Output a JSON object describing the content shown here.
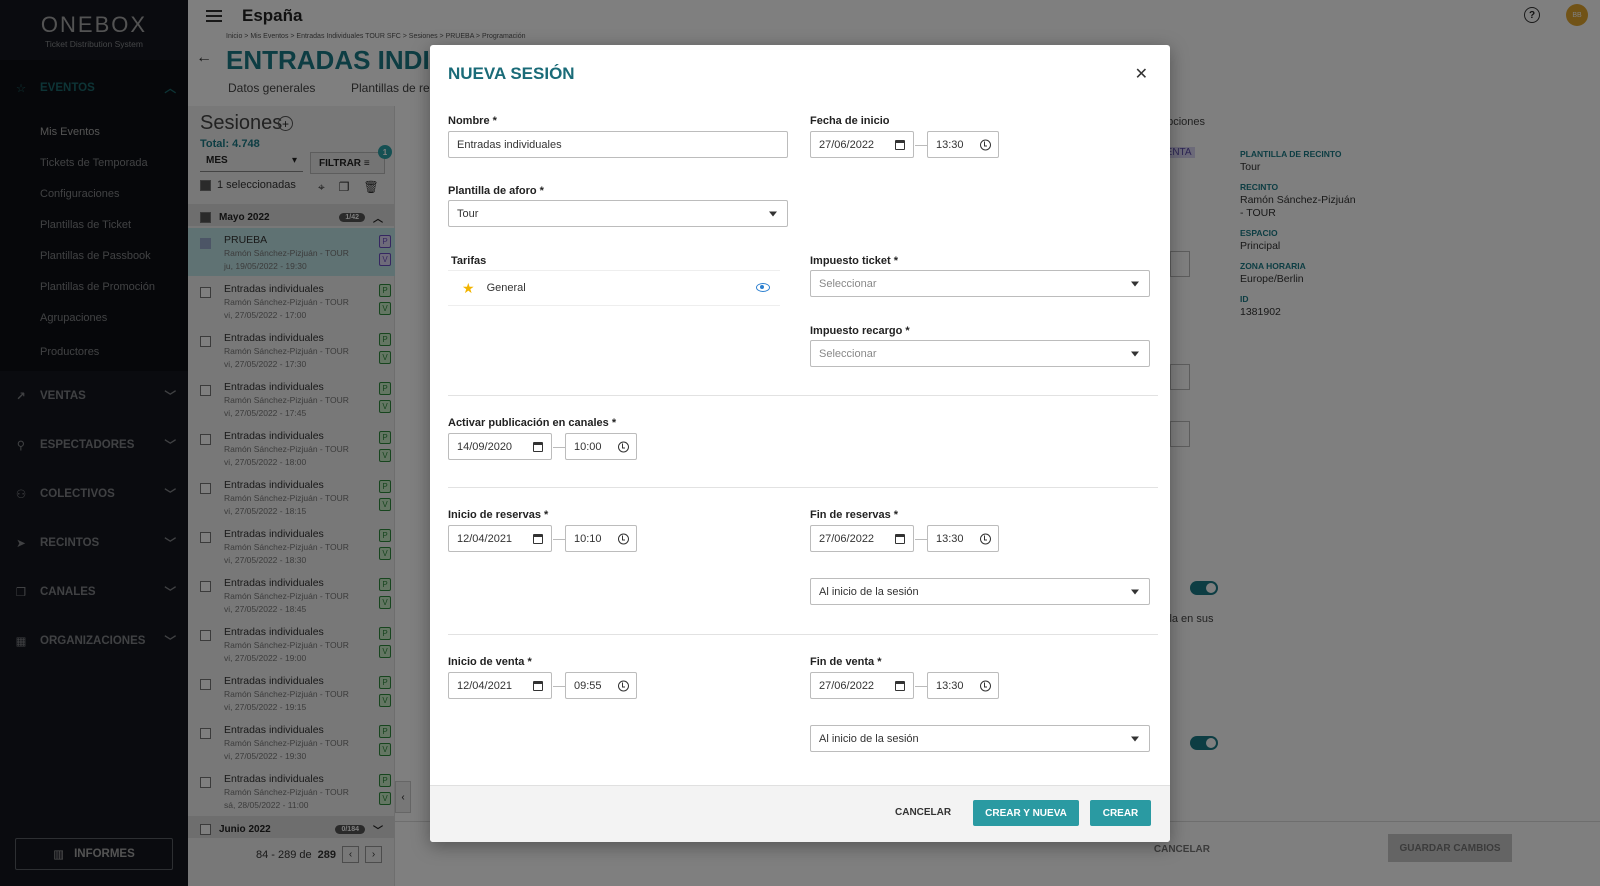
{
  "sidebar": {
    "logo": "ONEBOX",
    "logo_sub": "Ticket Distribution System",
    "sections": [
      {
        "label": "EVENTOS",
        "icon": "star-icon"
      },
      {
        "label": "VENTAS",
        "icon": "trend-icon"
      },
      {
        "label": "ESPECTADORES",
        "icon": "person-icon"
      },
      {
        "label": "COLECTIVOS",
        "icon": "group-icon"
      },
      {
        "label": "RECINTOS",
        "icon": "location-arrow-icon"
      },
      {
        "label": "CANALES",
        "icon": "copy-icon"
      },
      {
        "label": "ORGANIZACIONES",
        "icon": "building-icon"
      }
    ],
    "eventos_items": [
      "Mis Eventos",
      "Tickets de Temporada",
      "Configuraciones",
      "Plantillas de Ticket",
      "Plantillas de Passbook",
      "Plantillas de Promoción",
      "Agrupaciones",
      "Productores"
    ],
    "informes_label": "INFORMES"
  },
  "topbar": {
    "country": "España",
    "help": "?",
    "avatar_initials": "BB"
  },
  "page": {
    "breadcrumb": "Inicio > Mis Eventos > Entradas Individuales TOUR SFC > Sesiones > PRUEBA > Programación",
    "title": "ENTRADAS INDIVIDUALES TOUR SFC",
    "tabs": [
      "Datos generales",
      "Plantillas de re"
    ],
    "right_fragments": {
      "opciones": "opciones",
      "venta_badge": "VENTA",
      "text_frag": "rarla en sus"
    },
    "info": {
      "items": [
        {
          "label": "PLANTILLA DE RECINTO",
          "value": "Tour"
        },
        {
          "label": "RECINTO",
          "value": "Ramón Sánchez-Pizjuán - TOUR"
        },
        {
          "label": "ESPACIO",
          "value": "Principal"
        },
        {
          "label": "ZONA HORARIA",
          "value": "Europe/Berlin"
        },
        {
          "label": "ID",
          "value": "1381902"
        }
      ]
    },
    "footer": {
      "cancel": "CANCELAR",
      "save": "GUARDAR CAMBIOS"
    }
  },
  "sessions": {
    "title": "Sesiones",
    "total": "Total: 4.748",
    "period": "MES",
    "filter_label": "FILTRAR",
    "filter_count": "1",
    "selected_label": "1 seleccionadas",
    "month": "Mayo 2022",
    "month_count": "1/42",
    "next_month": "Junio 2022",
    "next_month_count": "0/184",
    "items": [
      {
        "name": "PRUEBA",
        "venue": "Ramón Sánchez-Pizjuán - TOUR",
        "date": "ju, 19/05/2022 - 19:30",
        "tags": [
          "P",
          "V"
        ]
      },
      {
        "name": "Entradas individuales",
        "venue": "Ramón Sánchez-Pizjuán - TOUR",
        "date": "vi, 27/05/2022 - 17:00",
        "tags": [
          "P",
          "V"
        ]
      },
      {
        "name": "Entradas individuales",
        "venue": "Ramón Sánchez-Pizjuán - TOUR",
        "date": "vi, 27/05/2022 - 17:30",
        "tags": [
          "P",
          "V"
        ]
      },
      {
        "name": "Entradas individuales",
        "venue": "Ramón Sánchez-Pizjuán - TOUR",
        "date": "vi, 27/05/2022 - 17:45",
        "tags": [
          "P",
          "V"
        ]
      },
      {
        "name": "Entradas individuales",
        "venue": "Ramón Sánchez-Pizjuán - TOUR",
        "date": "vi, 27/05/2022 - 18:00",
        "tags": [
          "P",
          "V"
        ]
      },
      {
        "name": "Entradas individuales",
        "venue": "Ramón Sánchez-Pizjuán - TOUR",
        "date": "vi, 27/05/2022 - 18:15",
        "tags": [
          "P",
          "V"
        ]
      },
      {
        "name": "Entradas individuales",
        "venue": "Ramón Sánchez-Pizjuán - TOUR",
        "date": "vi, 27/05/2022 - 18:30",
        "tags": [
          "P",
          "V"
        ]
      },
      {
        "name": "Entradas individuales",
        "venue": "Ramón Sánchez-Pizjuán - TOUR",
        "date": "vi, 27/05/2022 - 18:45",
        "tags": [
          "P",
          "V"
        ]
      },
      {
        "name": "Entradas individuales",
        "venue": "Ramón Sánchez-Pizjuán - TOUR",
        "date": "vi, 27/05/2022 - 19:00",
        "tags": [
          "P",
          "V"
        ]
      },
      {
        "name": "Entradas individuales",
        "venue": "Ramón Sánchez-Pizjuán - TOUR",
        "date": "vi, 27/05/2022 - 19:15",
        "tags": [
          "P",
          "V"
        ]
      },
      {
        "name": "Entradas individuales",
        "venue": "Ramón Sánchez-Pizjuán - TOUR",
        "date": "vi, 27/05/2022 - 19:30",
        "tags": [
          "P",
          "V"
        ]
      },
      {
        "name": "Entradas individuales",
        "venue": "Ramón Sánchez-Pizjuán - TOUR",
        "date": "sá, 28/05/2022 - 11:00",
        "tags": [
          "P",
          "V"
        ]
      }
    ],
    "pager": {
      "range": "84 - 289 de",
      "total": "289"
    }
  },
  "modal": {
    "title": "NUEVA SESIÓN",
    "nombre_label": "Nombre *",
    "nombre_value": "Entradas individuales",
    "fecha_inicio_label": "Fecha de inicio",
    "fecha_inicio_date": "27/06/2022",
    "fecha_inicio_time": "13:30",
    "plantilla_label": "Plantilla de aforo *",
    "plantilla_value": "Tour",
    "tarifas_label": "Tarifas",
    "tarifa_name": "General",
    "impuesto_ticket_label": "Impuesto ticket *",
    "impuesto_ticket_placeholder": "Seleccionar",
    "impuesto_recargo_label": "Impuesto recargo *",
    "impuesto_recargo_placeholder": "Seleccionar",
    "activar_label": "Activar publicación en canales *",
    "activar_date": "14/09/2020",
    "activar_time": "10:00",
    "inicio_reservas_label": "Inicio de reservas *",
    "inicio_reservas_date": "12/04/2021",
    "inicio_reservas_time": "10:10",
    "fin_reservas_label": "Fin de reservas *",
    "fin_reservas_date": "27/06/2022",
    "fin_reservas_time": "13:30",
    "fin_reservas_option": "Al inicio de la sesión",
    "inicio_venta_label": "Inicio de venta *",
    "inicio_venta_date": "12/04/2021",
    "inicio_venta_time": "09:55",
    "fin_venta_label": "Fin de venta *",
    "fin_venta_date": "27/06/2022",
    "fin_venta_time": "13:30",
    "fin_venta_option": "Al inicio de la sesión",
    "buttons": {
      "cancel": "CANCELAR",
      "create_new": "CREAR Y NUEVA",
      "create": "CREAR"
    }
  },
  "colors": {
    "accent": "#2a9aa2",
    "title": "#1a6b78",
    "sidebar_bg": "#1f2430"
  }
}
